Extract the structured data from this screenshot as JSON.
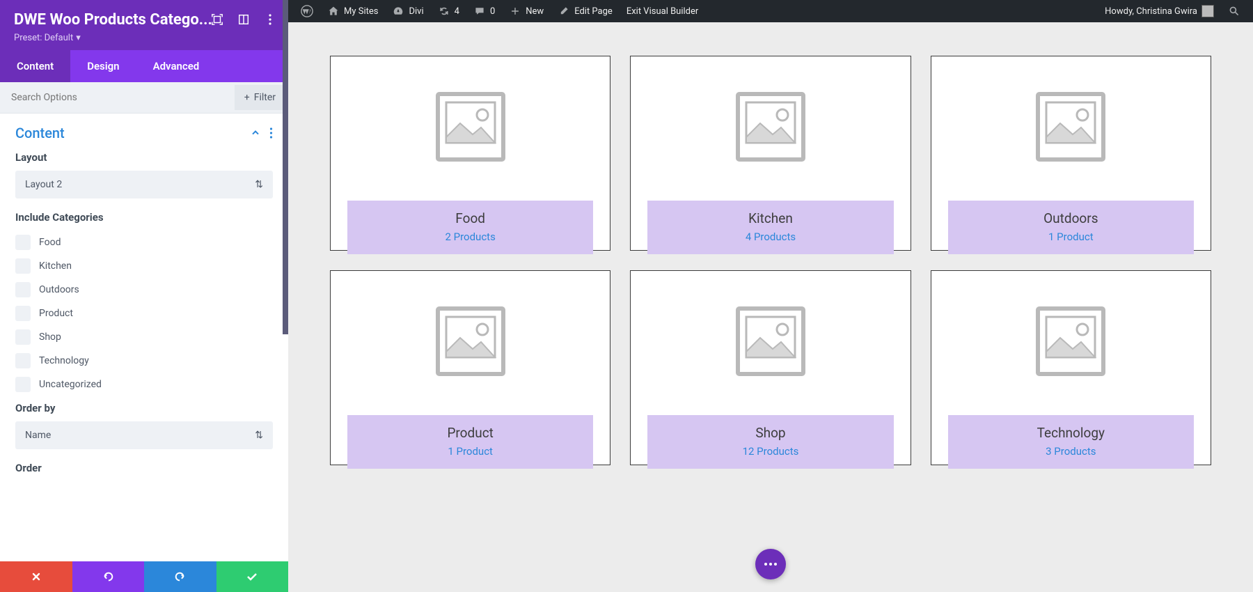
{
  "adminbar": {
    "mysites": "My Sites",
    "divi": "Divi",
    "updates": "4",
    "comments": "0",
    "new": "New",
    "editpage": "Edit Page",
    "exitvb": "Exit Visual Builder",
    "howdy": "Howdy, Christina Gwira"
  },
  "sidebar": {
    "title": "DWE Woo Products Catego...",
    "preset": "Preset: Default",
    "tabs": {
      "content": "Content",
      "design": "Design",
      "advanced": "Advanced"
    },
    "search_placeholder": "Search Options",
    "filter": "Filter",
    "section_title": "Content",
    "layout_label": "Layout",
    "layout_value": "Layout 2",
    "include_label": "Include Categories",
    "categories": [
      "Food",
      "Kitchen",
      "Outdoors",
      "Product",
      "Shop",
      "Technology",
      "Uncategorized"
    ],
    "orderby_label": "Order by",
    "orderby_value": "Name",
    "order_label": "Order"
  },
  "cards": [
    {
      "name": "Food",
      "count": "2 Products"
    },
    {
      "name": "Kitchen",
      "count": "4 Products"
    },
    {
      "name": "Outdoors",
      "count": "1 Product"
    },
    {
      "name": "Product",
      "count": "1 Product"
    },
    {
      "name": "Shop",
      "count": "12 Products"
    },
    {
      "name": "Technology",
      "count": "3 Products"
    }
  ]
}
